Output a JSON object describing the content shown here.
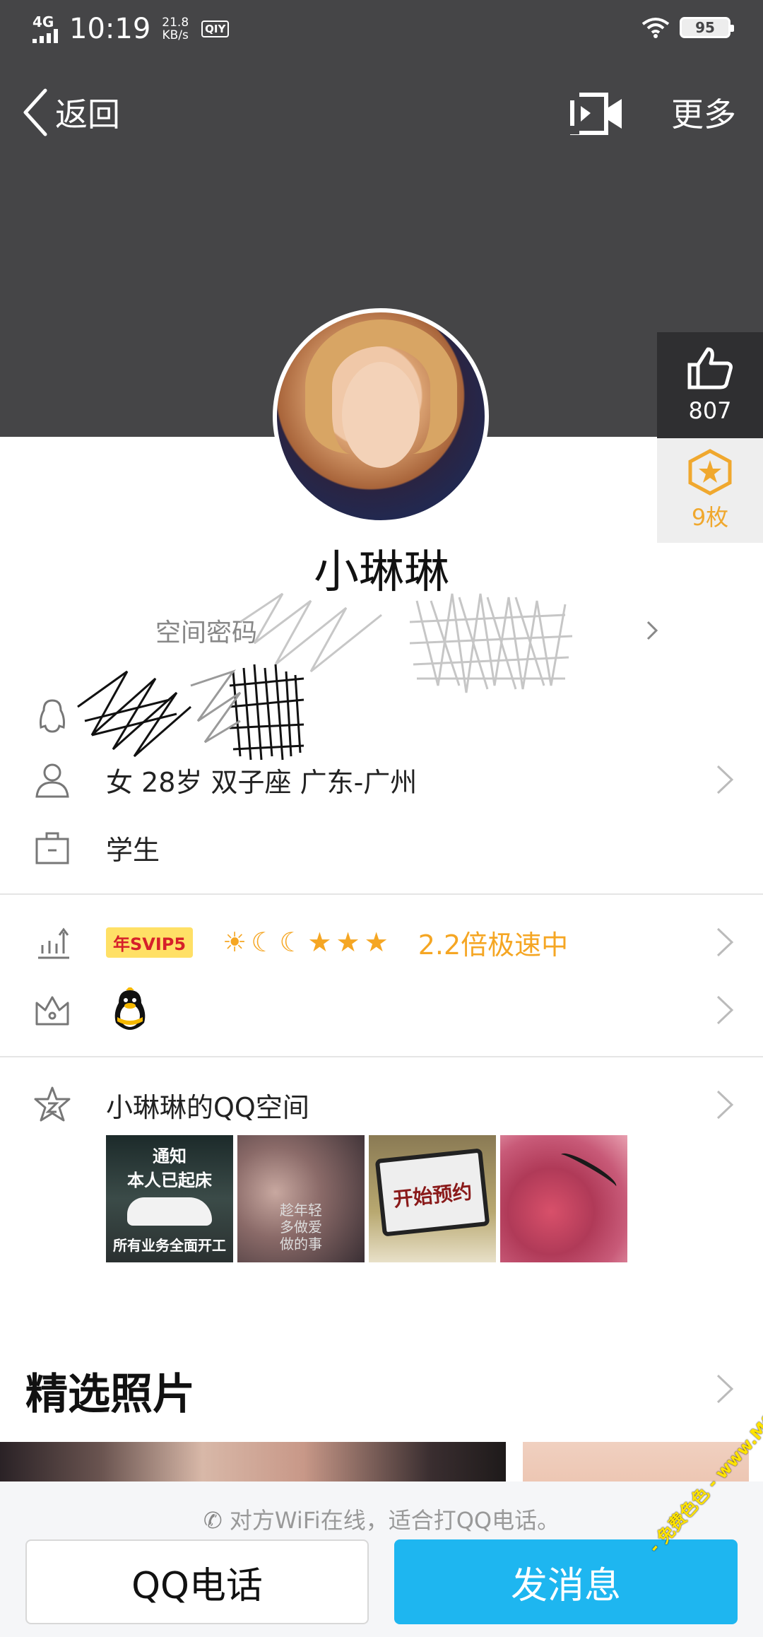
{
  "status_bar": {
    "network": "4G",
    "time": "10:19",
    "speed_value": "21.8",
    "speed_unit": "KB/s",
    "app_badge": "QIY",
    "battery": "95"
  },
  "nav": {
    "back_label": "返回",
    "more_label": "更多"
  },
  "profile": {
    "nickname": "小琳琳",
    "signature": "空间密码",
    "like_count": "807",
    "medal_count": "9枚"
  },
  "info": {
    "basic": "女  28岁  双子座  广东-广州",
    "occupation": "学生",
    "svip_badge": "年SVIP5",
    "vip_speed": "2.2倍极速中"
  },
  "qzone": {
    "title": "小琳琳的QQ空间",
    "thumbnails": [
      {
        "caption_1": "通知",
        "caption_2": "本人已起床",
        "caption_3": "所有业务全面开工"
      },
      {
        "caption_1": "趁年轻",
        "caption_2": "多做爱",
        "caption_3": "做的事"
      },
      {
        "caption_1": "开始预约"
      },
      {}
    ]
  },
  "featured": {
    "title": "精选照片"
  },
  "bottom": {
    "call_hint": "对方WiFi在线，适合打QQ电话。",
    "call_button": "QQ电话",
    "message_button": "发消息"
  },
  "watermark": "- 免费色色 - www.Mfsese.com",
  "colors": {
    "header": "#454547",
    "accent_blue": "#1eb6f0",
    "vip_orange": "#f5a623"
  }
}
